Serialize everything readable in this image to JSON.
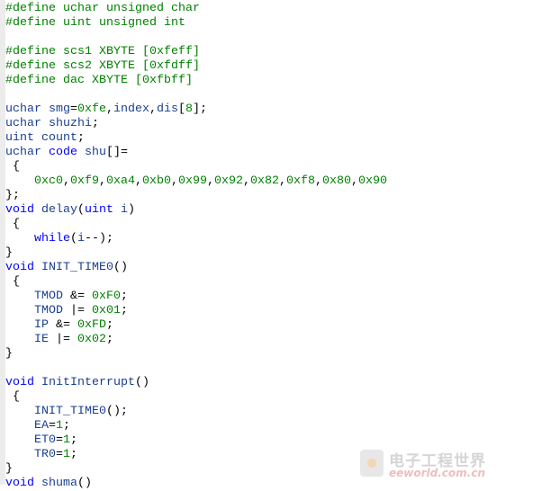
{
  "editor": {
    "lines": [
      [
        [
          "#define uchar unsigned char",
          "p"
        ]
      ],
      [
        [
          "#define uint unsigned int",
          "p"
        ]
      ],
      [],
      [
        [
          "#define scs1 XBYTE [0xfeff]",
          "p"
        ]
      ],
      [
        [
          "#define scs2 XBYTE [0xfdff]",
          "p"
        ]
      ],
      [
        [
          "#define dac XBYTE [0xfbff]",
          "p"
        ]
      ],
      [],
      [
        [
          "uchar smg",
          "i"
        ],
        [
          "=",
          "o"
        ],
        [
          "0xfe",
          "n"
        ],
        [
          ",",
          "o"
        ],
        [
          "index",
          "i"
        ],
        [
          ",",
          "o"
        ],
        [
          "dis",
          "i"
        ],
        [
          "[",
          "o"
        ],
        [
          "8",
          "n"
        ],
        [
          "];",
          "o"
        ]
      ],
      [
        [
          "uchar shuzhi",
          "i"
        ],
        [
          ";",
          "o"
        ]
      ],
      [
        [
          "uint count",
          "i"
        ],
        [
          ";",
          "o"
        ]
      ],
      [
        [
          "uchar ",
          "i"
        ],
        [
          "code",
          "k"
        ],
        [
          " shu",
          "i"
        ],
        [
          "[]=",
          "o"
        ]
      ],
      [
        [
          " {",
          "o"
        ]
      ],
      [
        [
          "    ",
          "o"
        ],
        [
          "0xc0",
          "n"
        ],
        [
          ",",
          "o"
        ],
        [
          "0xf9",
          "n"
        ],
        [
          ",",
          "o"
        ],
        [
          "0xa4",
          "n"
        ],
        [
          ",",
          "o"
        ],
        [
          "0xb0",
          "n"
        ],
        [
          ",",
          "o"
        ],
        [
          "0x99",
          "n"
        ],
        [
          ",",
          "o"
        ],
        [
          "0x92",
          "n"
        ],
        [
          ",",
          "o"
        ],
        [
          "0x82",
          "n"
        ],
        [
          ",",
          "o"
        ],
        [
          "0xf8",
          "n"
        ],
        [
          ",",
          "o"
        ],
        [
          "0x80",
          "n"
        ],
        [
          ",",
          "o"
        ],
        [
          "0x90",
          "n"
        ]
      ],
      [
        [
          "};",
          "o"
        ]
      ],
      [
        [
          "void",
          "k"
        ],
        [
          " delay",
          "i"
        ],
        [
          "(",
          "o"
        ],
        [
          "uint",
          "k"
        ],
        [
          " i",
          "i"
        ],
        [
          ")",
          "o"
        ]
      ],
      [
        [
          " {",
          "o"
        ]
      ],
      [
        [
          "    ",
          "o"
        ],
        [
          "while",
          "k"
        ],
        [
          "(",
          "o"
        ],
        [
          "i",
          "i"
        ],
        [
          "--);",
          "o"
        ]
      ],
      [
        [
          "}",
          "o"
        ]
      ],
      [
        [
          "void",
          "k"
        ],
        [
          " INIT_TIME0",
          "i"
        ],
        [
          "()",
          "o"
        ]
      ],
      [
        [
          " {",
          "o"
        ]
      ],
      [
        [
          "    TMOD ",
          "i"
        ],
        [
          "&= ",
          "o"
        ],
        [
          "0xF0",
          "n"
        ],
        [
          ";",
          "o"
        ]
      ],
      [
        [
          "    TMOD ",
          "i"
        ],
        [
          "|= ",
          "o"
        ],
        [
          "0x01",
          "n"
        ],
        [
          ";",
          "o"
        ]
      ],
      [
        [
          "    IP ",
          "i"
        ],
        [
          "&= ",
          "o"
        ],
        [
          "0xFD",
          "n"
        ],
        [
          ";",
          "o"
        ]
      ],
      [
        [
          "    IE ",
          "i"
        ],
        [
          "|= ",
          "o"
        ],
        [
          "0x02",
          "n"
        ],
        [
          ";",
          "o"
        ]
      ],
      [
        [
          "}",
          "o"
        ]
      ],
      [],
      [
        [
          "void",
          "k"
        ],
        [
          " InitInterrupt",
          "i"
        ],
        [
          "()",
          "o"
        ]
      ],
      [
        [
          " {",
          "o"
        ]
      ],
      [
        [
          "    INIT_TIME0",
          "i"
        ],
        [
          "();",
          "o"
        ]
      ],
      [
        [
          "    EA",
          "i"
        ],
        [
          "=",
          "o"
        ],
        [
          "1",
          "n"
        ],
        [
          ";",
          "o"
        ]
      ],
      [
        [
          "    ET0",
          "i"
        ],
        [
          "=",
          "o"
        ],
        [
          "1",
          "n"
        ],
        [
          ";",
          "o"
        ]
      ],
      [
        [
          "    TR0",
          "i"
        ],
        [
          "=",
          "o"
        ],
        [
          "1",
          "n"
        ],
        [
          ";",
          "o"
        ]
      ],
      [
        [
          "}",
          "o"
        ]
      ],
      [
        [
          "void",
          "k"
        ],
        [
          " shuma",
          "i"
        ],
        [
          "()",
          "o"
        ]
      ]
    ]
  },
  "colors": {
    "preprocessor": "#008000",
    "identifier": "#1a3f8f",
    "keyword": "#0000ff",
    "number": "#008000"
  },
  "watermark": {
    "chinese": "电子工程世界",
    "site": "eeworld.com.cn"
  }
}
